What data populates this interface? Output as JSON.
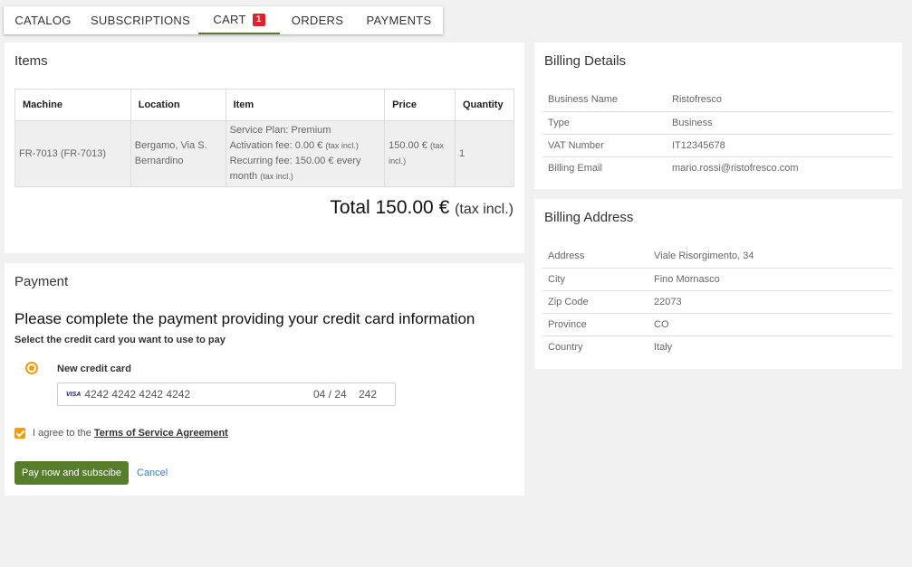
{
  "tabs": [
    {
      "label": "CATALOG"
    },
    {
      "label": "SUBSCRIPTIONS"
    },
    {
      "label": "CART",
      "badge": "1"
    },
    {
      "label": "ORDERS"
    },
    {
      "label": "PAYMENTS"
    }
  ],
  "items": {
    "title": "Items",
    "headers": [
      "Machine",
      "Location",
      "Item",
      "Price",
      "Quantity"
    ],
    "row": {
      "machine": "FR-7013 (FR-7013)",
      "location": "Bergamo, Via S. Bernardino",
      "plan": "Service Plan: Premium",
      "activation": "Activation fee: 0.00 €",
      "activation_tax": "(tax incl.)",
      "recurring": "Recurring fee: 150.00 € every month",
      "recurring_tax": "(tax incl.)",
      "price": "150.00 €",
      "price_tax": "(tax incl.)",
      "quantity": "1"
    },
    "total_label": "Total 150.00 €",
    "total_tax": "(tax incl.)"
  },
  "payment": {
    "title": "Payment",
    "heading": "Please complete the payment providing your credit card information",
    "subheading": "Select the credit card you want to use to pay",
    "new_card_label": "New credit card",
    "card_brand": "VISA",
    "card_number": "4242 4242 4242 4242",
    "card_expiry": "04 / 24",
    "card_cvc": "242",
    "agree_text": "I agree to the",
    "agree_link": "Terms of Service Agreement",
    "pay_button": "Pay now and subscibe",
    "cancel_link": "Cancel"
  },
  "billing_details": {
    "title": "Billing Details",
    "rows": [
      {
        "label": "Business Name",
        "value": "Ristofresco"
      },
      {
        "label": "Type",
        "value": "Business"
      },
      {
        "label": "VAT Number",
        "value": "IT12345678"
      },
      {
        "label": "Billing Email",
        "value": "mario.rossi@ristofresco.com"
      }
    ]
  },
  "billing_address": {
    "title": "Billing Address",
    "rows": [
      {
        "label": "Address",
        "value": "Viale Risorgimento, 34"
      },
      {
        "label": "City",
        "value": "Fino Mornasco"
      },
      {
        "label": "Zip Code",
        "value": "22073"
      },
      {
        "label": "Province",
        "value": "CO"
      },
      {
        "label": "Country",
        "value": "Italy"
      }
    ]
  },
  "colors": {
    "accent_green": "#567d2a",
    "orange": "#f39c12",
    "badge_red": "#d9232e",
    "link_blue": "#3a7bd5"
  }
}
